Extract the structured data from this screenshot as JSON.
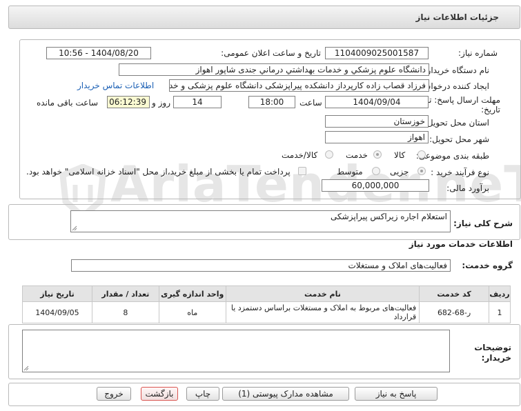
{
  "header": {
    "title": "جزئیات اطلاعات نیاز"
  },
  "watermark": {
    "text": "AriaTender.neT"
  },
  "form": {
    "need_number_label": "شماره نیاز:",
    "need_number": "1104009025001587",
    "announce_label": "تاریخ و ساعت اعلان عمومی:",
    "announce_value": "1404/08/20 - 10:56",
    "buyer_org_label": "نام دستگاه خریدار:",
    "buyer_org": "دانشگاه علوم پزشکي و خدمات بهداشتي درماني جندی شاپور اهواز",
    "requester_label": "ایجاد کننده درخواست:",
    "requester": "فرزاد قصاب زاده کارپرداز دانشکده پیراپزشکی دانشگاه علوم پزشکی و خدمات بهداشتی درمانی جندی شاپور اهواز",
    "buyer_contact_link": "اطلاعات تماس خریدار",
    "deadline_label": "مهلت ارسال پاسخ: تا تاریخ:",
    "deadline_date": "1404/09/04",
    "time_label": "ساعت",
    "deadline_time": "18:00",
    "days_value": "14",
    "days_label": "روز و",
    "remaining_time": "06:12:39",
    "remaining_label": "ساعت باقی مانده",
    "province_label": "استان محل تحویل:",
    "province": "خوزستان",
    "city_label": "شهر محل تحویل:",
    "city": "اهواز",
    "category_label": "طبقه بندی موضوعی:",
    "category_options": [
      "کالا",
      "خدمت",
      "کالا/خدمت"
    ],
    "category_selected": "خدمت",
    "purchase_type_label": "نوع فرآیند خرید :",
    "purchase_options": [
      "جزیی",
      "متوسط"
    ],
    "purchase_selected": "جزیی",
    "payment_note": "پرداخت تمام یا بخشی از مبلغ خرید،از محل \"اسناد خزانه اسلامی\" خواهد بود.",
    "estimate_label": "برآورد مالی:",
    "estimate": "60,000,000"
  },
  "summary": {
    "label": "شرح کلی نیاز:",
    "value": "استعلام اجاره زیراکس پیراپزشکی"
  },
  "services": {
    "section_title": "اطلاعات خدمات مورد نیاز",
    "group_label": "گروه خدمت:",
    "group_value": "فعالیت‌های  املاک و مستغلات",
    "table": {
      "headers": [
        "ردیف",
        "کد خدمت",
        "نام خدمت",
        "واحد اندازه گیری",
        "تعداد / مقدار",
        "تاریخ نیاز"
      ],
      "rows": [
        [
          "1",
          "ر-68-682",
          "فعالیت‌های مربوط به املاک و مستغلات براساس دستمزد یا قرارداد",
          "ماه",
          "8",
          "1404/09/05"
        ]
      ]
    }
  },
  "buyer_notes": {
    "label": "توضیحات خریدار:",
    "value": ""
  },
  "buttons": {
    "reply": "پاسخ به نیاز",
    "attachments": "مشاهده مدارک پیوستی (1)",
    "print": "چاپ",
    "back": "بازگشت",
    "exit": "خروج"
  }
}
